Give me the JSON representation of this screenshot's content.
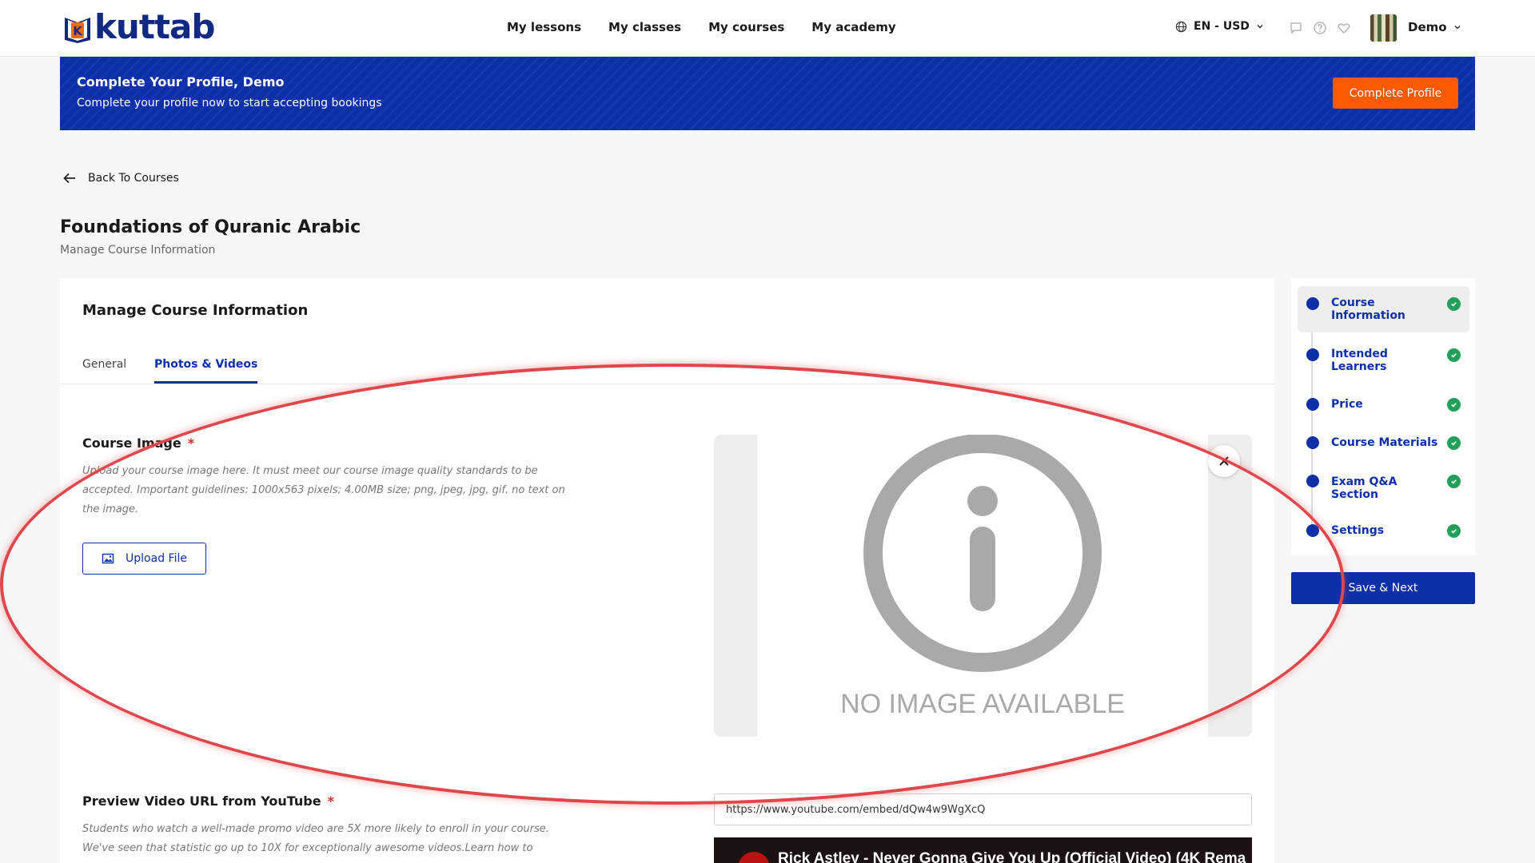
{
  "header": {
    "logo_text": "kuttab",
    "nav": [
      "My lessons",
      "My classes",
      "My courses",
      "My academy"
    ],
    "language": "EN - USD",
    "user_name": "Demo"
  },
  "banner": {
    "title": "Complete Your Profile, Demo",
    "subtitle": "Complete your profile now to start accepting bookings",
    "button": "Complete Profile"
  },
  "back_link": "Back To Courses",
  "page": {
    "title": "Foundations of Quranic Arabic",
    "subtitle": "Manage Course Information"
  },
  "card": {
    "title": "Manage Course Information",
    "tabs": [
      "General",
      "Photos & Videos"
    ],
    "active_tab": "Photos & Videos",
    "course_image": {
      "label": "Course Image",
      "required_mark": "*",
      "help": "Upload your course image here. It must meet our course image quality standards to be accepted. Important guidelines: 1000x563 pixels; 4.00MB size; png, jpeg, jpg, gif. no text on the image.",
      "upload_button": "Upload File",
      "placeholder_text": "NO IMAGE AVAILABLE"
    },
    "preview_video": {
      "label": "Preview Video URL from YouTube",
      "required_mark": "*",
      "help": "Students who watch a well-made promo video are 5X more likely to enroll in your course. We've seen that statistic go up to 10X for exceptionally awesome videos.Learn how to",
      "url_value": "https://www.youtube.com/embed/dQw4w9WgXcQ",
      "video_title": "Rick Astley - Never Gonna Give You Up (Official Video) (4K Rema"
    }
  },
  "steps": [
    {
      "label": "Course Information",
      "done": true,
      "active": true
    },
    {
      "label": "Intended Learners",
      "done": true,
      "active": false
    },
    {
      "label": "Price",
      "done": true,
      "active": false
    },
    {
      "label": "Course Materials",
      "done": true,
      "active": false
    },
    {
      "label": "Exam Q&A Section",
      "done": true,
      "active": false
    },
    {
      "label": "Settings",
      "done": true,
      "active": false
    }
  ],
  "save_button": "Save & Next",
  "colors": {
    "primary": "#0d2fa8",
    "accent": "#ff5a00",
    "success": "#22a05a",
    "annotation": "#e0464b"
  }
}
